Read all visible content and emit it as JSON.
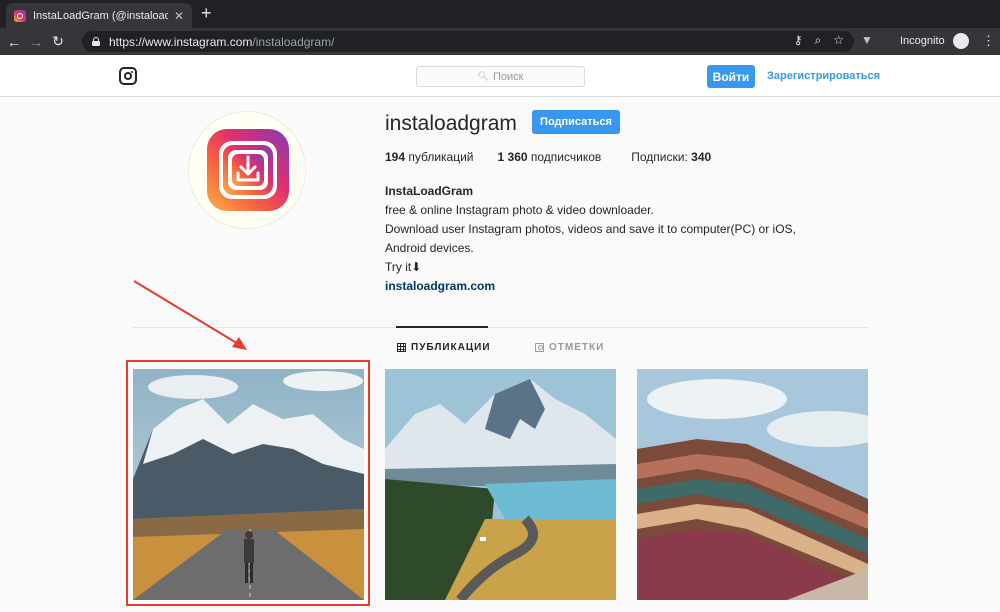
{
  "browser": {
    "tab_title": "InstaLoadGram (@instaloadgram)",
    "url_host": "https://www.instagram.com",
    "url_path": "/instaloadgram/",
    "incognito_label": "Incognito"
  },
  "header": {
    "search_placeholder": "Поиск",
    "login_label": "Войти",
    "signup_label": "Зарегистрироваться"
  },
  "profile": {
    "username": "instaloadgram",
    "follow_label": "Подписаться",
    "posts_count": "194",
    "posts_label": "публикаций",
    "followers_count": "1 360",
    "followers_label": "подписчиков",
    "following_label": "Подписки:",
    "following_count": "340",
    "bio_name": "InstaLoadGram",
    "bio_line1": "free & online Instagram photo & video downloader.",
    "bio_line2": "Download user Instagram photos, videos and save it to computer(PC) or iOS,",
    "bio_line3": "Android devices.",
    "bio_line4": "Try it⬇",
    "bio_link": "instaloadgram.com"
  },
  "tabs": {
    "posts_label": "ПУБЛИКАЦИИ",
    "tagged_label": "ОТМЕТКИ"
  },
  "colors": {
    "accent": "#3897f0",
    "highlight": "#e53c2e"
  }
}
